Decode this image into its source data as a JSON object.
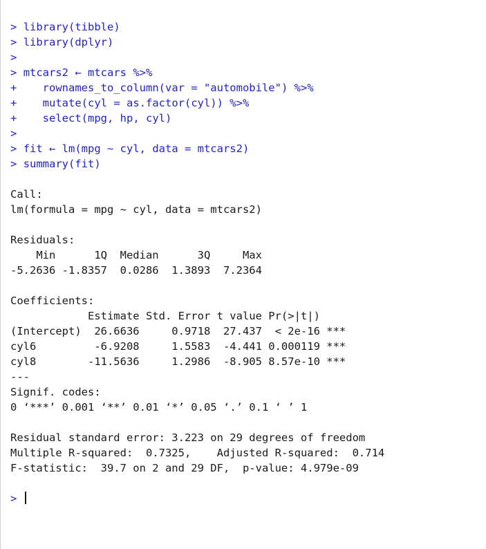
{
  "prompt": {
    "primary": ">",
    "continuation": "+"
  },
  "input_lines": [
    "library(tibble)",
    "library(dplyr)",
    "",
    "mtcars2 ← mtcars %>%",
    "   rownames_to_column(var = \"automobile\") %>%",
    "   mutate(cyl = as.factor(cyl)) %>%",
    "   select(mpg, hp, cyl)",
    "",
    "fit ← lm(mpg ~ cyl, data = mtcars2)",
    "summary(fit)"
  ],
  "input_prompts": [
    ">",
    ">",
    ">",
    ">",
    "+",
    "+",
    "+",
    ">",
    ">",
    ">"
  ],
  "output": {
    "blank1": "",
    "call_header": "Call:",
    "call_body": "lm(formula = mpg ~ cyl, data = mtcars2)",
    "blank2": "",
    "residuals_header": "Residuals:",
    "residuals_cols": "    Min      1Q  Median      3Q     Max ",
    "residuals_vals": "-5.2636 -1.8357  0.0286  1.3893  7.2364 ",
    "blank3": "",
    "coef_header": "Coefficients:",
    "coef_cols": "            Estimate Std. Error t value Pr(>|t|)    ",
    "coef_row1": "(Intercept)  26.6636     0.9718  27.437  < 2e-16 ***",
    "coef_row2": "cyl6         -6.9208     1.5583  -4.441 0.000119 ***",
    "coef_row3": "cyl8        -11.5636     1.2986  -8.905 8.57e-10 ***",
    "signif_sep": "---",
    "signif_h": "Signif. codes:  ",
    "signif_c": "0 ‘***’ 0.001 ‘**’ 0.01 ‘*’ 0.05 ‘.’ 0.1 ‘ ’ 1",
    "blank4": "",
    "rse": "Residual standard error: 3.223 on 29 degrees of freedom",
    "r2": "Multiple R-squared:  0.7325,\tAdjusted R-squared:  0.714 ",
    "fstat": "F-statistic:  39.7 on 2 and 29 DF,  p-value: 4.979e-09",
    "blank5": ""
  },
  "final_prompt": "> "
}
